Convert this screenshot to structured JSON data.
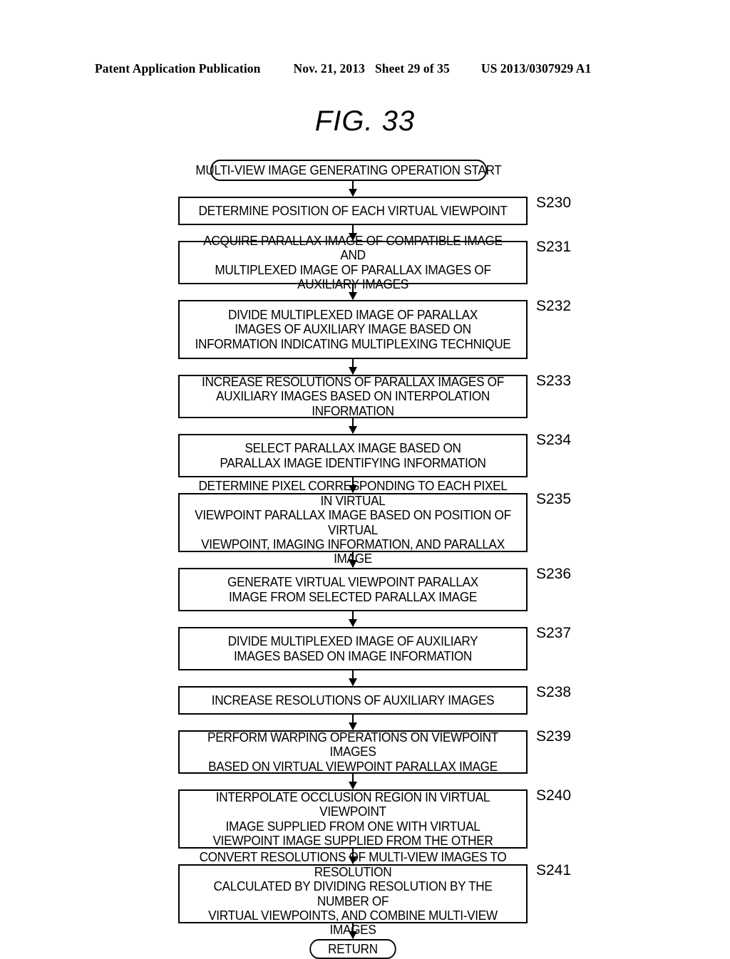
{
  "header": {
    "publication": "Patent Application Publication",
    "date": "Nov. 21, 2013",
    "sheet": "Sheet 29 of 35",
    "patent_number": "US 2013/0307929 A1"
  },
  "figure": {
    "title": "FIG. 33"
  },
  "flowchart": {
    "start": {
      "label": "MULTI-VIEW IMAGE GENERATING OPERATION START",
      "shape": "terminator"
    },
    "end": {
      "label": "RETURN",
      "shape": "terminator"
    },
    "steps": [
      {
        "id": "S230",
        "text": "DETERMINE POSITION OF EACH VIRTUAL VIEWPOINT"
      },
      {
        "id": "S231",
        "text": "ACQUIRE PARALLAX IMAGE OF COMPATIBLE IMAGE AND\nMULTIPLEXED IMAGE OF PARALLAX IMAGES OF AUXILIARY IMAGES"
      },
      {
        "id": "S232",
        "text": "DIVIDE MULTIPLEXED IMAGE OF PARALLAX\nIMAGES OF AUXILIARY IMAGE BASED ON\nINFORMATION INDICATING MULTIPLEXING TECHNIQUE"
      },
      {
        "id": "S233",
        "text": "INCREASE RESOLUTIONS OF PARALLAX IMAGES OF\nAUXILIARY IMAGES BASED ON INTERPOLATION INFORMATION"
      },
      {
        "id": "S234",
        "text": "SELECT PARALLAX IMAGE BASED ON\nPARALLAX IMAGE IDENTIFYING INFORMATION"
      },
      {
        "id": "S235",
        "text": "DETERMINE PIXEL CORRESPONDING TO EACH PIXEL IN VIRTUAL\nVIEWPOINT PARALLAX IMAGE BASED ON POSITION OF VIRTUAL\nVIEWPOINT, IMAGING INFORMATION, AND PARALLAX IMAGE"
      },
      {
        "id": "S236",
        "text": "GENERATE VIRTUAL VIEWPOINT PARALLAX\nIMAGE FROM SELECTED PARALLAX IMAGE"
      },
      {
        "id": "S237",
        "text": "DIVIDE MULTIPLEXED IMAGE OF AUXILIARY\nIMAGES BASED ON IMAGE INFORMATION"
      },
      {
        "id": "S238",
        "text": "INCREASE RESOLUTIONS OF AUXILIARY IMAGES"
      },
      {
        "id": "S239",
        "text": "PERFORM WARPING OPERATIONS ON VIEWPOINT IMAGES\nBASED ON VIRTUAL VIEWPOINT PARALLAX IMAGE"
      },
      {
        "id": "S240",
        "text": "INTERPOLATE OCCLUSION REGION IN VIRTUAL VIEWPOINT\nIMAGE SUPPLIED FROM ONE WITH VIRTUAL\nVIEWPOINT IMAGE SUPPLIED FROM THE OTHER"
      },
      {
        "id": "S241",
        "text": "CONVERT RESOLUTIONS OF MULTI-VIEW IMAGES TO RESOLUTION\nCALCULATED BY DIVIDING RESOLUTION BY THE NUMBER OF\nVIRTUAL VIEWPOINTS, AND COMBINE MULTI-VIEW IMAGES"
      }
    ]
  },
  "colors": {
    "ink": "#000000",
    "paper": "#ffffff"
  }
}
